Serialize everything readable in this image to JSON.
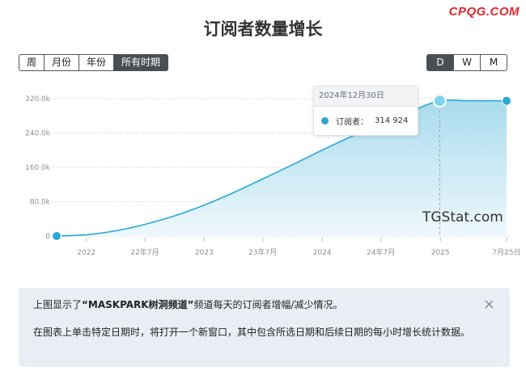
{
  "watermark": "CPQG.COM",
  "title": "订阅者数量增长",
  "range_buttons": [
    {
      "label": "周",
      "active": false
    },
    {
      "label": "月份",
      "active": false
    },
    {
      "label": "年份",
      "active": false
    },
    {
      "label": "所有时期",
      "active": true
    }
  ],
  "granularity_buttons": [
    {
      "label": "D",
      "active": true
    },
    {
      "label": "W",
      "active": false
    },
    {
      "label": "M",
      "active": false
    }
  ],
  "colors": {
    "line": "#2aa9d3",
    "area_top": "#a9dbed",
    "area_bottom": "#eef8fc",
    "grid": "#d7dbe0"
  },
  "chart_data": {
    "type": "area",
    "x_tick_labels": [
      "2022",
      "22年7月",
      "2023",
      "23年7月",
      "2024",
      "24年7月",
      "2025",
      "7月25日"
    ],
    "y_tick_labels": [
      "0",
      "80.0k",
      "160.0k",
      "240.0k",
      "320.0k"
    ],
    "ylim": [
      0,
      320000
    ],
    "series": [
      {
        "name": "订阅者",
        "points": [
          {
            "x": "2021-10-01",
            "y": 0
          },
          {
            "x": "2022-01-01",
            "y": 3000
          },
          {
            "x": "2022-04-01",
            "y": 12000
          },
          {
            "x": "2022-07-01",
            "y": 27000
          },
          {
            "x": "2022-10-01",
            "y": 47000
          },
          {
            "x": "2023-01-01",
            "y": 72000
          },
          {
            "x": "2023-04-01",
            "y": 101000
          },
          {
            "x": "2023-07-01",
            "y": 133000
          },
          {
            "x": "2023-10-01",
            "y": 166000
          },
          {
            "x": "2024-01-01",
            "y": 200000
          },
          {
            "x": "2024-04-01",
            "y": 232000
          },
          {
            "x": "2024-07-01",
            "y": 262000
          },
          {
            "x": "2024-10-01",
            "y": 290000
          },
          {
            "x": "2024-12-30",
            "y": 314924
          },
          {
            "x": "2025-04-01",
            "y": 314924
          },
          {
            "x": "2025-07-25",
            "y": 314924
          }
        ]
      }
    ],
    "highlight": {
      "x": "2024-12-30",
      "y": 314924
    },
    "grid": true
  },
  "brand": "TGStat.com",
  "tooltip": {
    "date": "2024年12月30日",
    "label": "订阅者：",
    "value": "314 924"
  },
  "info": {
    "p1_prefix": "上图显示了",
    "p1_channel": "“MASKPARK树洞频道”",
    "p1_suffix": "频道每天的订阅者增幅/减少情况。",
    "p2": "在图表上单击特定日期时，将打开一个新窗口，其中包含所选日期和后续日期的每小时增长统计数据。",
    "close": "×"
  }
}
